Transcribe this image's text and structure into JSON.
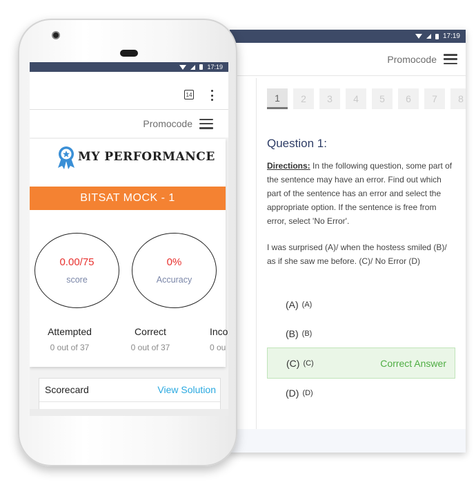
{
  "status_bar": {
    "time": "17:19"
  },
  "back_screen": {
    "promocode_label": "Promocode",
    "question_numbers": [
      "1",
      "2",
      "3",
      "4",
      "5",
      "6",
      "7",
      "8"
    ],
    "active_question_index": 0,
    "question_title": "Question 1:",
    "directions_label": "Directions:",
    "directions_text": " In the following question, some part of the sentence may have an error. Find out which part of the sentence has an error and select the appropriate option. If the sentence is free from error, select 'No Error'.",
    "question_text": "I was surprised (A)/ when the hostess smiled (B)/ as if she saw me before. (C)/ No Error (D)",
    "options": [
      {
        "label": "(A)",
        "sub": "(A)"
      },
      {
        "label": "(B)",
        "sub": "(B)"
      },
      {
        "label": "(C)",
        "sub": "(C)",
        "correct": true
      },
      {
        "label": "(D)",
        "sub": "(D)"
      }
    ],
    "correct_answer_label": "Correct Answer",
    "correct_color": "#4fad43"
  },
  "front_screen": {
    "tab_count": "14",
    "promocode_label": "Promocode",
    "performance_title": "MY PERFORMANCE",
    "exam_banner": "BITSAT MOCK - 1",
    "banner_color": "#f48232",
    "score_value": "0.00/75",
    "score_label": "score",
    "accuracy_value": "0%",
    "accuracy_label": "Accuracy",
    "stats": [
      {
        "heading": "Attempted",
        "value": "0 out of 37"
      },
      {
        "heading": "Correct",
        "value": "0 out of 37"
      },
      {
        "heading": "Inco",
        "value": "0 ou"
      }
    ],
    "scorecard_label": "Scorecard",
    "view_solution_label": "View Solution",
    "link_color": "#2aa9e0"
  },
  "icons": [
    "wifi-icon",
    "signal-icon",
    "battery-icon",
    "tab-switcher-icon",
    "overflow-menu-icon",
    "hamburger-menu-icon",
    "ribbon-badge-icon",
    "camera-icon",
    "speaker-icon"
  ]
}
